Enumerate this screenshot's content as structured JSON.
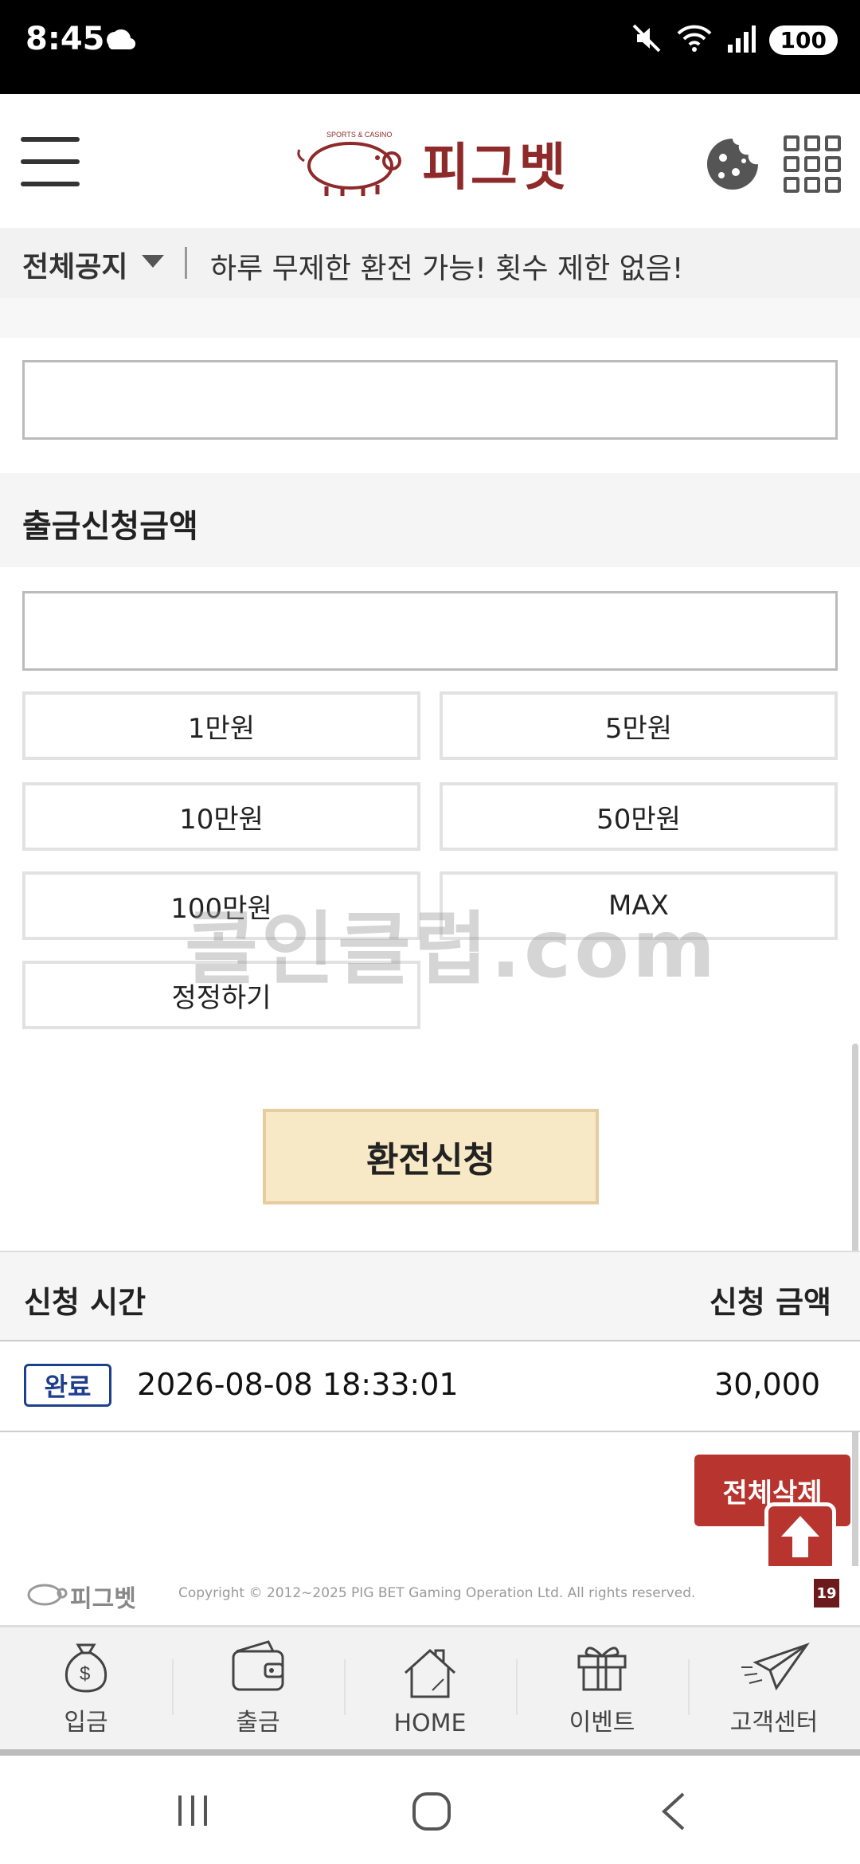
{
  "status_bar": {
    "time": "8:45",
    "battery": "100",
    "icons": [
      "weather-icon",
      "mute-icon",
      "wifi-icon",
      "signal-icon"
    ]
  },
  "header": {
    "brand_name": "피그벳",
    "brand_tagline": "SPORTS & CASINO"
  },
  "notice": {
    "label": "전체공지",
    "message": "하루 무제한 환전 가능! 횟수 제한 없음!"
  },
  "withdraw_form": {
    "amount_label": "출금신청금액",
    "amount_buttons": [
      "1만원",
      "5만원",
      "10만원",
      "50만원",
      "100만원",
      "MAX"
    ],
    "reset_label": "정정하기",
    "submit_label": "환전신청"
  },
  "watermark": "콜인클럽.com",
  "history": {
    "col_time": "신청 시간",
    "col_amount": "신청 금액",
    "rows": [
      {
        "status": "완료",
        "time": "2026-08-08 18:33:01",
        "amount": "30,000"
      }
    ],
    "delete_all_label": "전체삭제"
  },
  "footer": {
    "logo_text": "피그벳",
    "copyright": "Copyright © 2012~2025 PIG BET Gaming Operation Ltd. All rights reserved.",
    "age_badge": "19"
  },
  "bottom_nav": {
    "items": [
      {
        "label": "입금",
        "icon": "money-bag-icon"
      },
      {
        "label": "출금",
        "icon": "wallet-icon"
      },
      {
        "label": "HOME",
        "icon": "home-icon"
      },
      {
        "label": "이벤트",
        "icon": "gift-icon"
      },
      {
        "label": "고객센터",
        "icon": "paper-plane-icon"
      }
    ]
  },
  "colors": {
    "brand": "#8e2a2a",
    "submit_bg": "#f7e8c6",
    "delete_bg": "#b8342f",
    "badge": "#1e3f8c"
  }
}
